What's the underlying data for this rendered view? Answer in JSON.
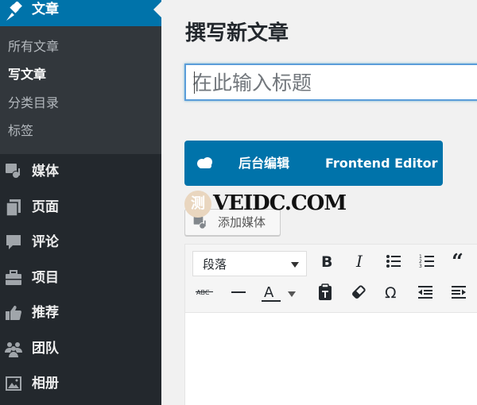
{
  "sidebar": {
    "current": {
      "label": "文章",
      "icon": "pin-icon"
    },
    "submenu": [
      {
        "label": "所有文章",
        "active": false
      },
      {
        "label": "写文章",
        "active": true
      },
      {
        "label": "分类目录",
        "active": false
      },
      {
        "label": "标签",
        "active": false
      }
    ],
    "items": [
      {
        "label": "媒体",
        "icon": "media-icon"
      },
      {
        "label": "页面",
        "icon": "pages-icon"
      },
      {
        "label": "评论",
        "icon": "comment-icon"
      },
      {
        "label": "项目",
        "icon": "portfolio-icon"
      },
      {
        "label": "推荐",
        "icon": "thumbs-up-icon"
      },
      {
        "label": "团队",
        "icon": "groups-icon"
      },
      {
        "label": "相册",
        "icon": "gallery-icon"
      }
    ]
  },
  "main": {
    "page_title": "撰写新文章",
    "title_placeholder": "在此输入标题",
    "editor_switch": {
      "backend_label": "后台编辑",
      "frontend_label": "Frontend Editor"
    },
    "watermark": {
      "seal": "测",
      "brand": "VEIDC.COM"
    },
    "add_media_label": "添加媒体",
    "toolbar": {
      "format_value": "段落",
      "row1": [
        "bold",
        "italic",
        "bullet-list",
        "numbered-list",
        "blockquote"
      ],
      "row2": [
        "strikethrough",
        "horizontal-rule",
        "text-color",
        "paste-as-text",
        "clear-formatting",
        "special-character",
        "outdent",
        "indent"
      ]
    }
  },
  "colors": {
    "admin_bar": "#23282d",
    "submenu": "#32373c",
    "accent": "#0073aa",
    "background": "#f1f1f1"
  }
}
